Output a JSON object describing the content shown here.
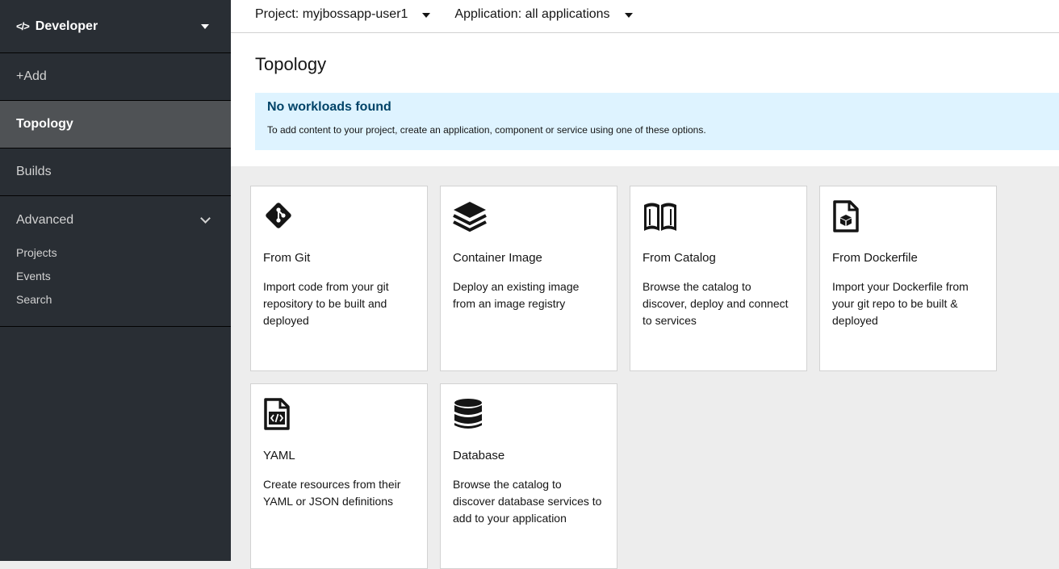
{
  "sidebar": {
    "perspective": "Developer",
    "items": [
      {
        "label": "+Add"
      },
      {
        "label": "Topology"
      },
      {
        "label": "Builds"
      }
    ],
    "advanced": {
      "label": "Advanced",
      "subitems": [
        "Projects",
        "Events",
        "Search"
      ]
    }
  },
  "topbar": {
    "project": "Project: myjbossapp-user1",
    "application": "Application: all applications"
  },
  "page": {
    "title": "Topology",
    "alert_title": "No workloads found",
    "alert_body": "To add content to your project, create an application, component or service using one of these options."
  },
  "cards": [
    {
      "title": "From Git",
      "desc": "Import code from your git repository to be built and deployed",
      "icon": "git-icon"
    },
    {
      "title": "Container Image",
      "desc": "Deploy an existing image from an image registry",
      "icon": "layers-icon"
    },
    {
      "title": "From Catalog",
      "desc": "Browse the catalog to discover, deploy and connect to services",
      "icon": "book-icon"
    },
    {
      "title": "From Dockerfile",
      "desc": "Import your Dockerfile from your git repo to be built & deployed",
      "icon": "dockerfile-icon"
    },
    {
      "title": "YAML",
      "desc": "Create resources from their YAML or JSON definitions",
      "icon": "code-file-icon"
    },
    {
      "title": "Database",
      "desc": "Browse the catalog to discover database services to add to your application",
      "icon": "database-icon"
    }
  ]
}
